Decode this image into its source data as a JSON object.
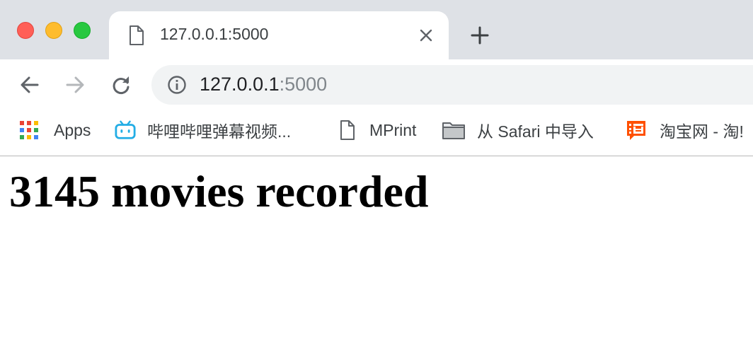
{
  "tab": {
    "title": "127.0.0.1:5000"
  },
  "omnibox": {
    "host": "127.0.0.1",
    "port": ":5000"
  },
  "bookmarks": [
    {
      "label": "Apps",
      "icon": "apps-grid-icon"
    },
    {
      "label": "哔哩哔哩弹幕视频...",
      "icon": "bilibili-icon"
    },
    {
      "label": "MPrint",
      "icon": "page-icon"
    },
    {
      "label": "从 Safari 中导入",
      "icon": "folder-icon"
    },
    {
      "label": "淘宝网 - 淘!",
      "icon": "taobao-icon"
    }
  ],
  "page": {
    "heading": "3145 movies recorded"
  },
  "colors": {
    "tabstrip": "#dee1e6",
    "omnibox": "#f1f3f4",
    "close": "#ff5f57",
    "minimize": "#febc2e",
    "maximize": "#28c840"
  }
}
